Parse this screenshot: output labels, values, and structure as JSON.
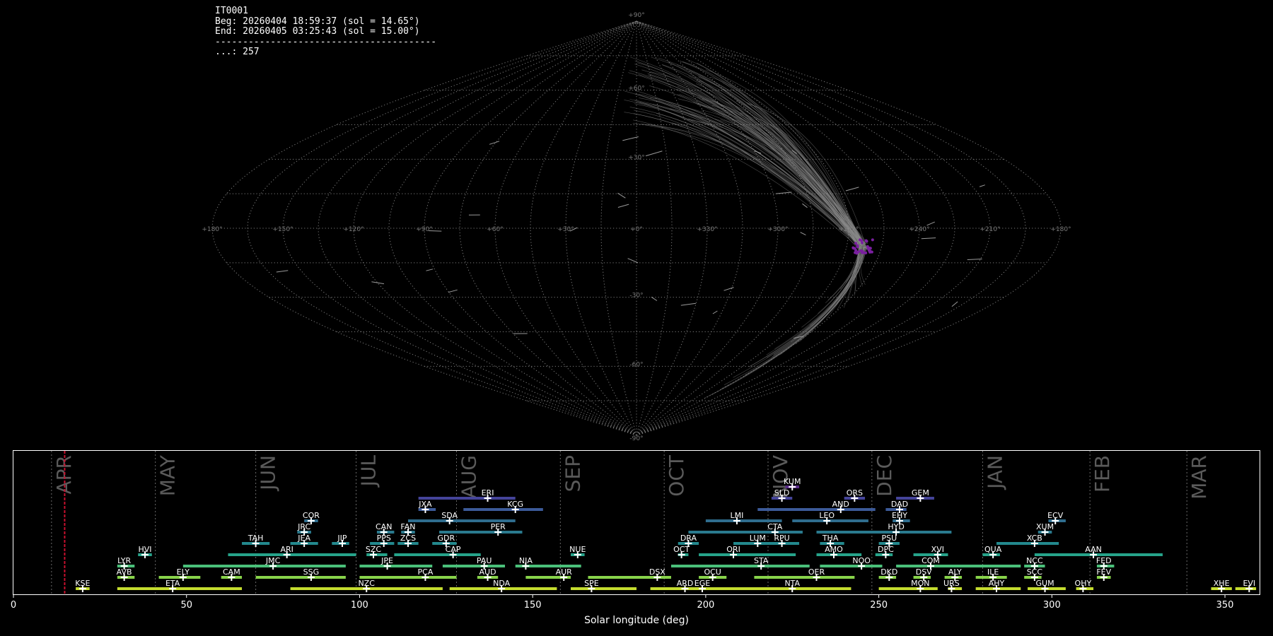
{
  "info": {
    "station": "IT0001",
    "begin": "Beg: 20260404 18:59:37 (sol = 14.65°)",
    "end": "End: 20260405 03:25:43 (sol = 15.00°)",
    "separator": "----------------------------------------",
    "count": "...: 257"
  },
  "colors": {
    "background": "#000000",
    "grid": "#7a7a7a",
    "highlight": "#c8102e",
    "radiant": "#7a1fa0",
    "month_text": "#5a5a5a"
  },
  "chart_data": [
    {
      "type": "scatter",
      "projection": "sinusoidal",
      "lat_ticks": [
        "+90°",
        "+60°",
        "+30°",
        "-30°",
        "-60°",
        "-90°"
      ],
      "lon_ticks": [
        "+180°",
        "+150°",
        "+120°",
        "+90°",
        "+60°",
        "+30°",
        "+0°",
        "+330°",
        "+300°",
        "+270°",
        "+240°",
        "+210°",
        "+180°"
      ],
      "grid": true
    },
    {
      "type": "timeline",
      "xlabel": "Solar longitude (deg)",
      "xlim": [
        0,
        360
      ],
      "x_ticks": [
        0,
        50,
        100,
        150,
        200,
        250,
        300,
        350
      ],
      "current_sol": 14.8,
      "months": [
        {
          "name": "APR",
          "start": 11
        },
        {
          "name": "MAY",
          "start": 41
        },
        {
          "name": "JUN",
          "start": 70
        },
        {
          "name": "JUL",
          "start": 99
        },
        {
          "name": "AUG",
          "start": 128
        },
        {
          "name": "SEP",
          "start": 158
        },
        {
          "name": "OCT",
          "start": 188
        },
        {
          "name": "NOV",
          "start": 218
        },
        {
          "name": "DEC",
          "start": 248
        },
        {
          "name": "JAN",
          "start": 280
        },
        {
          "name": "FEB",
          "start": 311
        },
        {
          "name": "MAR",
          "start": 339
        }
      ],
      "showers": [
        {
          "code": "KSE",
          "row": 0,
          "start": 18,
          "end": 22,
          "peak": 20
        },
        {
          "code": "ETA",
          "row": 0,
          "start": 30,
          "end": 66,
          "peak": 46
        },
        {
          "code": "NZC",
          "row": 0,
          "start": 80,
          "end": 124,
          "peak": 102
        },
        {
          "code": "NDA",
          "row": 0,
          "start": 126,
          "end": 157,
          "peak": 141
        },
        {
          "code": "SPE",
          "row": 0,
          "start": 161,
          "end": 180,
          "peak": 167
        },
        {
          "code": "ARD",
          "row": 0,
          "start": 184,
          "end": 200,
          "peak": 194
        },
        {
          "code": "EGE",
          "row": 0,
          "start": 198,
          "end": 214,
          "peak": 199
        },
        {
          "code": "NTA",
          "row": 0,
          "start": 210,
          "end": 242,
          "peak": 225
        },
        {
          "code": "MON",
          "row": 0,
          "start": 250,
          "end": 267,
          "peak": 262
        },
        {
          "code": "URS",
          "row": 0,
          "start": 270,
          "end": 274,
          "peak": 271
        },
        {
          "code": "AHY",
          "row": 0,
          "start": 278,
          "end": 291,
          "peak": 284
        },
        {
          "code": "GUM",
          "row": 0,
          "start": 293,
          "end": 304,
          "peak": 298
        },
        {
          "code": "OHY",
          "row": 0,
          "start": 307,
          "end": 312,
          "peak": 309
        },
        {
          "code": "XHE",
          "row": 0,
          "start": 346,
          "end": 352,
          "peak": 349
        },
        {
          "code": "EVI",
          "row": 0,
          "start": 353,
          "end": 359,
          "peak": 357
        },
        {
          "code": "AVB",
          "row": 1,
          "start": 30,
          "end": 35,
          "peak": 32
        },
        {
          "code": "ELY",
          "row": 1,
          "start": 42,
          "end": 54,
          "peak": 49
        },
        {
          "code": "CAM",
          "row": 1,
          "start": 60,
          "end": 66,
          "peak": 63
        },
        {
          "code": "SSG",
          "row": 1,
          "start": 70,
          "end": 96,
          "peak": 86
        },
        {
          "code": "PCA",
          "row": 1,
          "start": 100,
          "end": 128,
          "peak": 119
        },
        {
          "code": "AUD",
          "row": 1,
          "start": 134,
          "end": 140,
          "peak": 137
        },
        {
          "code": "AUR",
          "row": 1,
          "start": 148,
          "end": 161,
          "peak": 159
        },
        {
          "code": "DSX",
          "row": 1,
          "start": 166,
          "end": 190,
          "peak": 186
        },
        {
          "code": "OCU",
          "row": 1,
          "start": 198,
          "end": 206,
          "peak": 202
        },
        {
          "code": "OER",
          "row": 1,
          "start": 214,
          "end": 243,
          "peak": 232
        },
        {
          "code": "DKD",
          "row": 1,
          "start": 250,
          "end": 255,
          "peak": 253
        },
        {
          "code": "DSV",
          "row": 1,
          "start": 260,
          "end": 265,
          "peak": 263
        },
        {
          "code": "ALY",
          "row": 1,
          "start": 269,
          "end": 274,
          "peak": 272
        },
        {
          "code": "ILE",
          "row": 1,
          "start": 278,
          "end": 287,
          "peak": 283
        },
        {
          "code": "SCC",
          "row": 1,
          "start": 292,
          "end": 297,
          "peak": 295
        },
        {
          "code": "FEV",
          "row": 1,
          "start": 313,
          "end": 317,
          "peak": 315
        },
        {
          "code": "LYR",
          "row": 2,
          "start": 30,
          "end": 35,
          "peak": 32
        },
        {
          "code": "JMC",
          "row": 2,
          "start": 49,
          "end": 96,
          "peak": 75
        },
        {
          "code": "JPE",
          "row": 2,
          "start": 100,
          "end": 121,
          "peak": 108
        },
        {
          "code": "PAU",
          "row": 2,
          "start": 124,
          "end": 142,
          "peak": 136
        },
        {
          "code": "NIA",
          "row": 2,
          "start": 145,
          "end": 164,
          "peak": 148
        },
        {
          "code": "STA",
          "row": 2,
          "start": 190,
          "end": 230,
          "peak": 216
        },
        {
          "code": "NOO",
          "row": 2,
          "start": 233,
          "end": 251,
          "peak": 245
        },
        {
          "code": "COM",
          "row": 2,
          "start": 255,
          "end": 291,
          "peak": 265
        },
        {
          "code": "NCC",
          "row": 2,
          "start": 292,
          "end": 298,
          "peak": 295
        },
        {
          "code": "FED",
          "row": 2,
          "start": 313,
          "end": 318,
          "peak": 315
        },
        {
          "code": "HVI",
          "row": 3,
          "start": 36,
          "end": 40,
          "peak": 38
        },
        {
          "code": "ARI",
          "row": 3,
          "start": 62,
          "end": 99,
          "peak": 79
        },
        {
          "code": "SZC",
          "row": 3,
          "start": 102,
          "end": 108,
          "peak": 104
        },
        {
          "code": "CAP",
          "row": 3,
          "start": 110,
          "end": 135,
          "peak": 127
        },
        {
          "code": "NUE",
          "row": 3,
          "start": 161,
          "end": 165,
          "peak": 163
        },
        {
          "code": "OCT",
          "row": 3,
          "start": 192,
          "end": 195,
          "peak": 193
        },
        {
          "code": "ORI",
          "row": 3,
          "start": 198,
          "end": 226,
          "peak": 208
        },
        {
          "code": "AMO",
          "row": 3,
          "start": 232,
          "end": 245,
          "peak": 237
        },
        {
          "code": "DPC",
          "row": 3,
          "start": 249,
          "end": 254,
          "peak": 252
        },
        {
          "code": "XVI",
          "row": 3,
          "start": 260,
          "end": 270,
          "peak": 267
        },
        {
          "code": "QUA",
          "row": 3,
          "start": 280,
          "end": 285,
          "peak": 283
        },
        {
          "code": "AAN",
          "row": 3,
          "start": 295,
          "end": 332,
          "peak": 312
        },
        {
          "code": "TAH",
          "row": 4,
          "start": 66,
          "end": 74,
          "peak": 70
        },
        {
          "code": "JEA",
          "row": 4,
          "start": 80,
          "end": 88,
          "peak": 84
        },
        {
          "code": "JIP",
          "row": 4,
          "start": 92,
          "end": 97,
          "peak": 95
        },
        {
          "code": "PPS",
          "row": 4,
          "start": 103,
          "end": 110,
          "peak": 107
        },
        {
          "code": "ZCS",
          "row": 4,
          "start": 111,
          "end": 117,
          "peak": 114
        },
        {
          "code": "GDR",
          "row": 4,
          "start": 121,
          "end": 128,
          "peak": 125
        },
        {
          "code": "DRA",
          "row": 4,
          "start": 192,
          "end": 198,
          "peak": 195
        },
        {
          "code": "LUM",
          "row": 4,
          "start": 208,
          "end": 220,
          "peak": 215
        },
        {
          "code": "RPU",
          "row": 4,
          "start": 219,
          "end": 227,
          "peak": 222
        },
        {
          "code": "THA",
          "row": 4,
          "start": 233,
          "end": 240,
          "peak": 236
        },
        {
          "code": "PSU",
          "row": 4,
          "start": 250,
          "end": 256,
          "peak": 253
        },
        {
          "code": "XCB",
          "row": 4,
          "start": 284,
          "end": 302,
          "peak": 295
        },
        {
          "code": "JRC",
          "row": 5,
          "start": 82,
          "end": 86,
          "peak": 84
        },
        {
          "code": "CAN",
          "row": 5,
          "start": 105,
          "end": 110,
          "peak": 107
        },
        {
          "code": "FAN",
          "row": 5,
          "start": 112,
          "end": 116,
          "peak": 114
        },
        {
          "code": "PER",
          "row": 5,
          "start": 123,
          "end": 147,
          "peak": 140
        },
        {
          "code": "CTA",
          "row": 5,
          "start": 195,
          "end": 228,
          "peak": 220
        },
        {
          "code": "HYD",
          "row": 5,
          "start": 232,
          "end": 271,
          "peak": 255
        },
        {
          "code": "XUM",
          "row": 5,
          "start": 296,
          "end": 300,
          "peak": 298
        },
        {
          "code": "COR",
          "row": 6,
          "start": 84,
          "end": 88,
          "peak": 86
        },
        {
          "code": "SDA",
          "row": 6,
          "start": 114,
          "end": 145,
          "peak": 126
        },
        {
          "code": "LMI",
          "row": 6,
          "start": 200,
          "end": 222,
          "peak": 209
        },
        {
          "code": "LEO",
          "row": 6,
          "start": 225,
          "end": 247,
          "peak": 235
        },
        {
          "code": "EHY",
          "row": 6,
          "start": 254,
          "end": 259,
          "peak": 256
        },
        {
          "code": "ECV",
          "row": 6,
          "start": 299,
          "end": 304,
          "peak": 301
        },
        {
          "code": "JXA",
          "row": 7,
          "start": 117,
          "end": 122,
          "peak": 119
        },
        {
          "code": "KCG",
          "row": 7,
          "start": 130,
          "end": 153,
          "peak": 145
        },
        {
          "code": "AND",
          "row": 7,
          "start": 215,
          "end": 249,
          "peak": 239
        },
        {
          "code": "DAD",
          "row": 7,
          "start": 252,
          "end": 258,
          "peak": 256
        },
        {
          "code": "ERI",
          "row": 8,
          "start": 117,
          "end": 145,
          "peak": 137
        },
        {
          "code": "SLD",
          "row": 8,
          "start": 219,
          "end": 225,
          "peak": 222
        },
        {
          "code": "ORS",
          "row": 8,
          "start": 240,
          "end": 246,
          "peak": 243
        },
        {
          "code": "GEM",
          "row": 8,
          "start": 255,
          "end": 266,
          "peak": 262
        },
        {
          "code": "KUM",
          "row": 9,
          "start": 223,
          "end": 227,
          "peak": 225
        }
      ]
    }
  ]
}
